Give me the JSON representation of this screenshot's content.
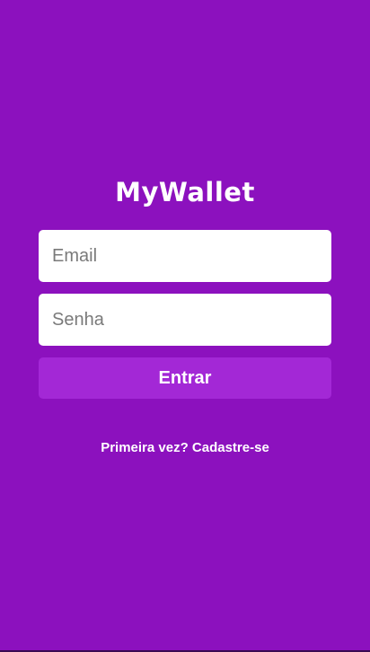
{
  "app": {
    "logo_text": "MyWallet"
  },
  "login_form": {
    "email_placeholder": "Email",
    "email_value": "",
    "password_placeholder": "Senha",
    "password_value": "",
    "submit_label": "Entrar"
  },
  "signup_link": {
    "label": "Primeira vez? Cadastre-se"
  },
  "colors": {
    "background": "#8c11be",
    "button": "#a328d6",
    "input_background": "#ffffff",
    "text": "#ffffff"
  }
}
